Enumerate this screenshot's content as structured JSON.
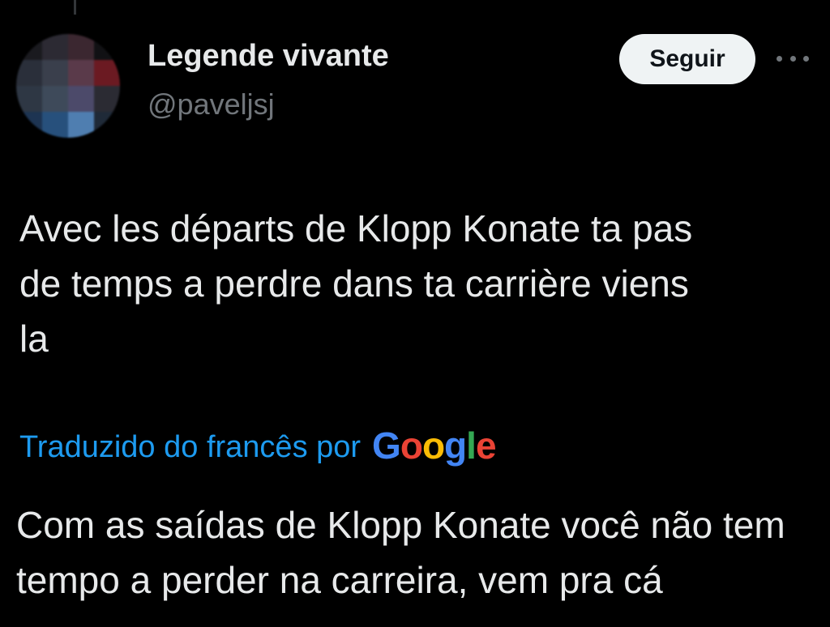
{
  "author": {
    "display_name": "Legende vivante",
    "handle": "@paveljsj"
  },
  "actions": {
    "follow_label": "Seguir",
    "more_icon": "more-horizontal-icon"
  },
  "tweet": {
    "text": "Avec les départs de Klopp Konate ta pas\nde temps a perdre dans ta carrière viens\nla"
  },
  "translation": {
    "label": "Traduzido do francês por",
    "provider_letters": [
      "G",
      "o",
      "o",
      "g",
      "l",
      "e"
    ],
    "provider_colors": [
      "#4285f4",
      "#ea4335",
      "#fbbc05",
      "#4285f4",
      "#34a853",
      "#ea4335"
    ],
    "text": "Com as saídas de Klopp Konate você não tem\ntempo a perder na carreira, vem pra cá"
  },
  "colors": {
    "background": "#000000",
    "primary_text": "#e7e9ea",
    "secondary_text": "#71767b",
    "link_blue": "#1d9bf0",
    "button_bg": "#eff3f4"
  }
}
